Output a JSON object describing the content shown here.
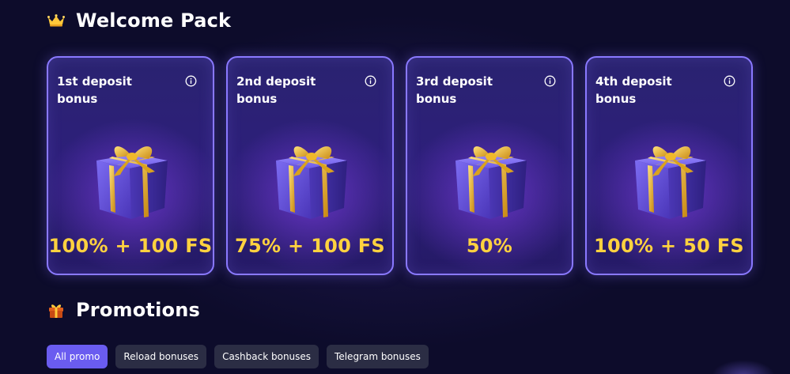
{
  "welcome": {
    "title": "Welcome Pack",
    "icon": "crown-icon",
    "cards": [
      {
        "title": "1st deposit\nbonus",
        "value": "100% + 100 FS",
        "icon": "gift-box-icon"
      },
      {
        "title": "2nd deposit\nbonus",
        "value": "75% + 100 FS",
        "icon": "gift-box-icon"
      },
      {
        "title": "3rd deposit\nbonus",
        "value": "50%",
        "icon": "gift-box-icon"
      },
      {
        "title": "4th deposit\nbonus",
        "value": "100% + 50 FS",
        "icon": "gift-box-icon"
      }
    ]
  },
  "promotions": {
    "title": "Promotions",
    "icon": "gift-icon",
    "filters": [
      {
        "label": "All promo",
        "active": true
      },
      {
        "label": "Reload bonuses",
        "active": false
      },
      {
        "label": "Cashback bonuses",
        "active": false
      },
      {
        "label": "Telegram bonuses",
        "active": false
      }
    ]
  },
  "colors": {
    "background": "#0d0c2b",
    "card_border": "#8a79ff",
    "value_text": "#ffd23f",
    "chip_active": "#6a5cf0",
    "chip_inactive": "#2b2d44"
  }
}
